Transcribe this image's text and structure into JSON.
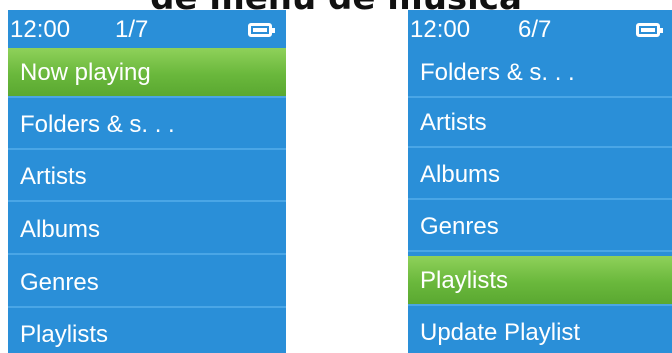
{
  "title": "de menú de música",
  "screens": [
    {
      "time": "12:00",
      "page": "1/7",
      "items": [
        {
          "label": "Now playing",
          "selected": true
        },
        {
          "label": "Folders & s. . .",
          "selected": false
        },
        {
          "label": "Artists",
          "selected": false
        },
        {
          "label": "Albums",
          "selected": false
        },
        {
          "label": "Genres",
          "selected": false
        },
        {
          "label": "Playlists",
          "selected": false
        }
      ]
    },
    {
      "time": "12:00",
      "page": "6/7",
      "items": [
        {
          "label": "Folders & s. . .",
          "selected": false
        },
        {
          "label": "Artists",
          "selected": false
        },
        {
          "label": "Albums",
          "selected": false
        },
        {
          "label": "Genres",
          "selected": false
        },
        {
          "label": "Playlists",
          "selected": true
        },
        {
          "label": "Update Playlist",
          "selected": false
        }
      ]
    }
  ],
  "colors": {
    "screen_bg": "#2a8fd8",
    "selected_bg": "#6ab83c",
    "text": "#ffffff"
  }
}
